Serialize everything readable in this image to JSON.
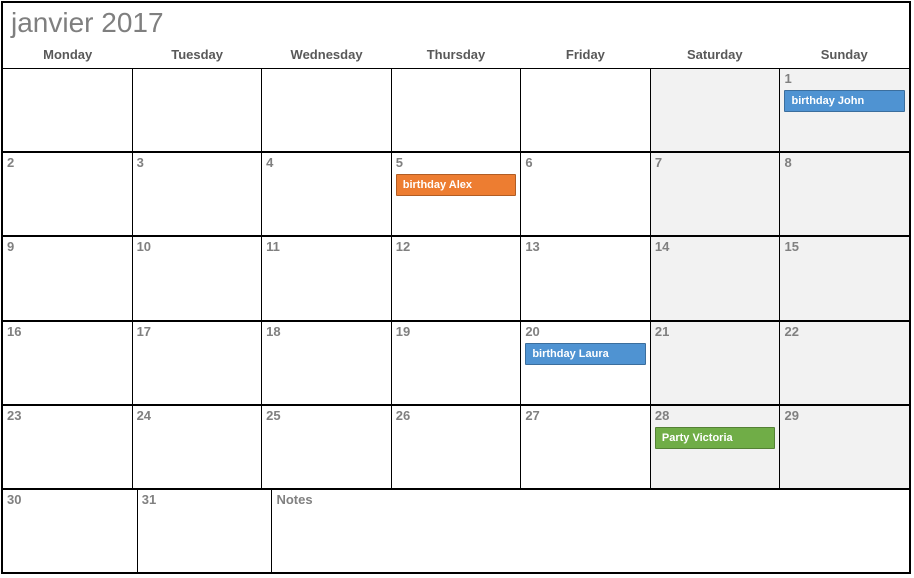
{
  "title": "janvier 2017",
  "day_headers": [
    "Monday",
    "Tuesday",
    "Wednesday",
    "Thursday",
    "Friday",
    "Saturday",
    "Sunday"
  ],
  "notes_label": "Notes",
  "colors": {
    "blue": "#4f93d2",
    "orange": "#ed7d31",
    "green": "#70ad47"
  },
  "weeks": [
    [
      {
        "num": "",
        "weekend": false
      },
      {
        "num": "",
        "weekend": false
      },
      {
        "num": "",
        "weekend": false
      },
      {
        "num": "",
        "weekend": false
      },
      {
        "num": "",
        "weekend": false
      },
      {
        "num": "",
        "weekend": true
      },
      {
        "num": "1",
        "weekend": true,
        "events": [
          {
            "label": "birthday John",
            "color": "blue"
          }
        ]
      }
    ],
    [
      {
        "num": "2",
        "weekend": false
      },
      {
        "num": "3",
        "weekend": false
      },
      {
        "num": "4",
        "weekend": false
      },
      {
        "num": "5",
        "weekend": false,
        "events": [
          {
            "label": "birthday Alex",
            "color": "orange"
          }
        ]
      },
      {
        "num": "6",
        "weekend": false
      },
      {
        "num": "7",
        "weekend": true
      },
      {
        "num": "8",
        "weekend": true
      }
    ],
    [
      {
        "num": "9",
        "weekend": false
      },
      {
        "num": "10",
        "weekend": false
      },
      {
        "num": "11",
        "weekend": false
      },
      {
        "num": "12",
        "weekend": false
      },
      {
        "num": "13",
        "weekend": false
      },
      {
        "num": "14",
        "weekend": true
      },
      {
        "num": "15",
        "weekend": true
      }
    ],
    [
      {
        "num": "16",
        "weekend": false
      },
      {
        "num": "17",
        "weekend": false
      },
      {
        "num": "18",
        "weekend": false
      },
      {
        "num": "19",
        "weekend": false
      },
      {
        "num": "20",
        "weekend": false,
        "events": [
          {
            "label": "birthday Laura",
            "color": "blue"
          }
        ]
      },
      {
        "num": "21",
        "weekend": true
      },
      {
        "num": "22",
        "weekend": true
      }
    ],
    [
      {
        "num": "23",
        "weekend": false
      },
      {
        "num": "24",
        "weekend": false
      },
      {
        "num": "25",
        "weekend": false
      },
      {
        "num": "26",
        "weekend": false
      },
      {
        "num": "27",
        "weekend": false
      },
      {
        "num": "28",
        "weekend": true,
        "events": [
          {
            "label": "Party Victoria",
            "color": "green"
          }
        ]
      },
      {
        "num": "29",
        "weekend": true
      }
    ],
    [
      {
        "num": "30",
        "weekend": false
      },
      {
        "num": "31",
        "weekend": false
      },
      {
        "notes": true
      }
    ]
  ]
}
